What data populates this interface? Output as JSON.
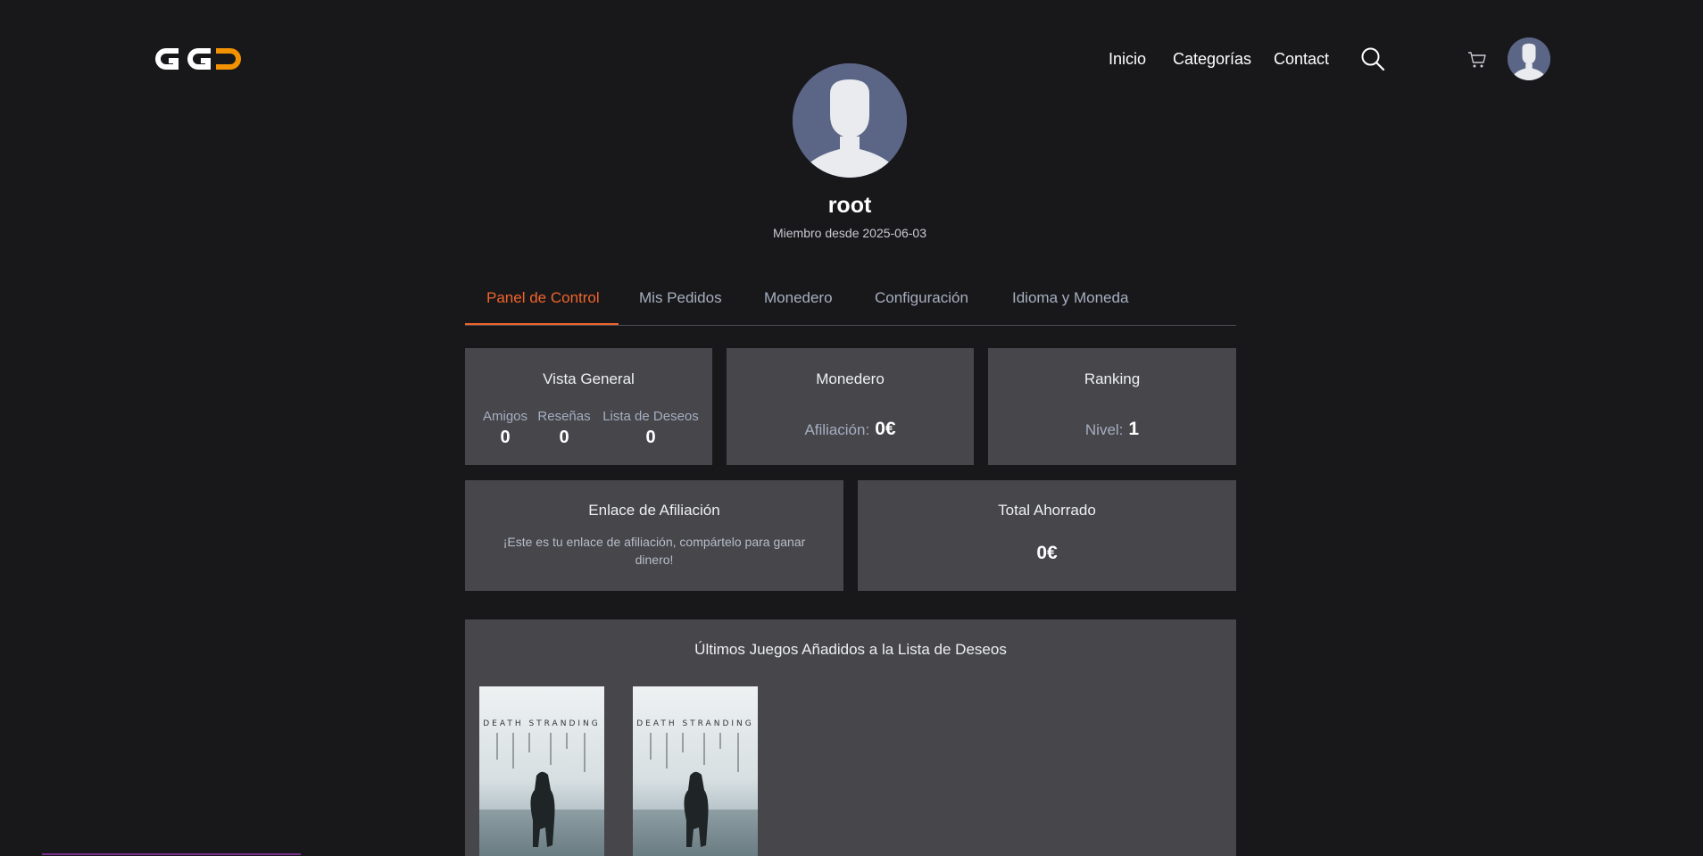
{
  "header": {
    "nav": [
      {
        "label": "Inicio"
      },
      {
        "label": "Categorías"
      },
      {
        "label": "Contact"
      }
    ],
    "icons": {
      "search": "search-icon",
      "cart": "cart-icon",
      "avatar": "user-avatar-icon"
    },
    "logo_colors": {
      "primary": "#ffffff",
      "accent": "#f39200"
    }
  },
  "profile": {
    "username": "root",
    "member_since_label": "Miembro desde",
    "member_since_date": "2025-06-03"
  },
  "tabs": [
    {
      "label": "Panel de Control",
      "active": true
    },
    {
      "label": "Mis Pedidos",
      "active": false
    },
    {
      "label": "Monedero",
      "active": false
    },
    {
      "label": "Configuración",
      "active": false
    },
    {
      "label": "Idioma y Moneda",
      "active": false
    }
  ],
  "overview": {
    "title": "Vista General",
    "stats": [
      {
        "label": "Amigos",
        "value": "0"
      },
      {
        "label": "Reseñas",
        "value": "0"
      },
      {
        "label": "Lista de Deseos",
        "value": "0"
      }
    ]
  },
  "wallet": {
    "title": "Monedero",
    "label": "Afiliación:",
    "value": "0€"
  },
  "ranking": {
    "title": "Ranking",
    "label": "Nivel:",
    "value": "1"
  },
  "affiliate": {
    "title": "Enlace de Afiliación",
    "description": "¡Este es tu enlace de afiliación, compártelo para ganar dinero!"
  },
  "savings": {
    "title": "Total Ahorrado",
    "value": "0€"
  },
  "wishlist": {
    "title": "Últimos Juegos Añadidos a la Lista de Deseos",
    "games": [
      {
        "cover_text": "DEATH STRANDING"
      },
      {
        "cover_text": "DEATH STRANDING"
      }
    ]
  },
  "colors": {
    "accent": "#f0642a",
    "background": "#18181b",
    "card": "#46464b",
    "avatar": "#5b6687"
  }
}
